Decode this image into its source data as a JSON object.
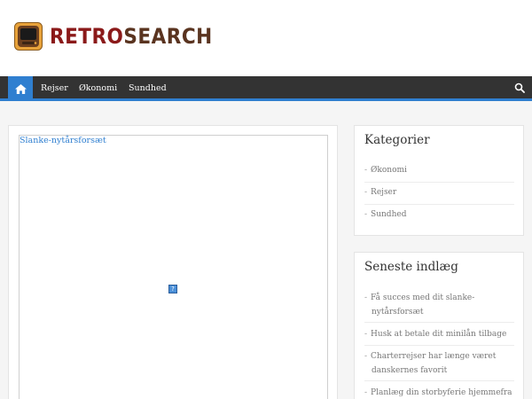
{
  "site": {
    "logo_part1": "RETRO",
    "logo_part2": "SEARCH"
  },
  "nav": {
    "items": [
      {
        "label": "Rejser"
      },
      {
        "label": "Økonomi"
      },
      {
        "label": "Sundhed"
      }
    ]
  },
  "main": {
    "ad_link": "Slanke-nytårsforsæt",
    "broken_image_glyph": "?"
  },
  "categories": {
    "title": "Kategorier",
    "items": [
      {
        "label": "Økonomi"
      },
      {
        "label": "Rejser"
      },
      {
        "label": "Sundhed"
      }
    ]
  },
  "recent": {
    "title": "Seneste indlæg",
    "items": [
      {
        "line1": "Få succes med dit slanke-",
        "line2": "nytårsforsæt"
      },
      {
        "line1": "Husk at betale dit minilån tilbage",
        "line2": ""
      },
      {
        "line1": "Charterrejser har længe været",
        "line2": "danskernes favorit"
      },
      {
        "line1": "Planlæg din storbyferie hjemmefra",
        "line2": ""
      }
    ]
  },
  "colors": {
    "accent": "#2f7fd0",
    "nav_bg": "#333333",
    "logo_red": "#8b1a1a",
    "logo_brown": "#5a3420"
  }
}
